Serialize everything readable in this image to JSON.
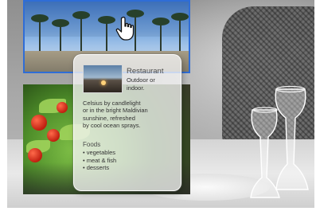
{
  "panel": {
    "title": "Restaurant",
    "subtitle_lines": [
      "Outdoor or",
      "indoor."
    ],
    "description_lines": [
      "Celsius by candlelight",
      "or in the bright Maldivian",
      "sunshine, refreshed",
      "by cool ocean sprays."
    ],
    "foods_title": "Foods",
    "foods": [
      "vegetables",
      "meat & fish",
      "desserts"
    ]
  },
  "colors": {
    "selection_border": "#2f6dd6",
    "panel_background": "#f5f5f5"
  },
  "icons": {
    "cursor": "hand-pointer-icon"
  }
}
